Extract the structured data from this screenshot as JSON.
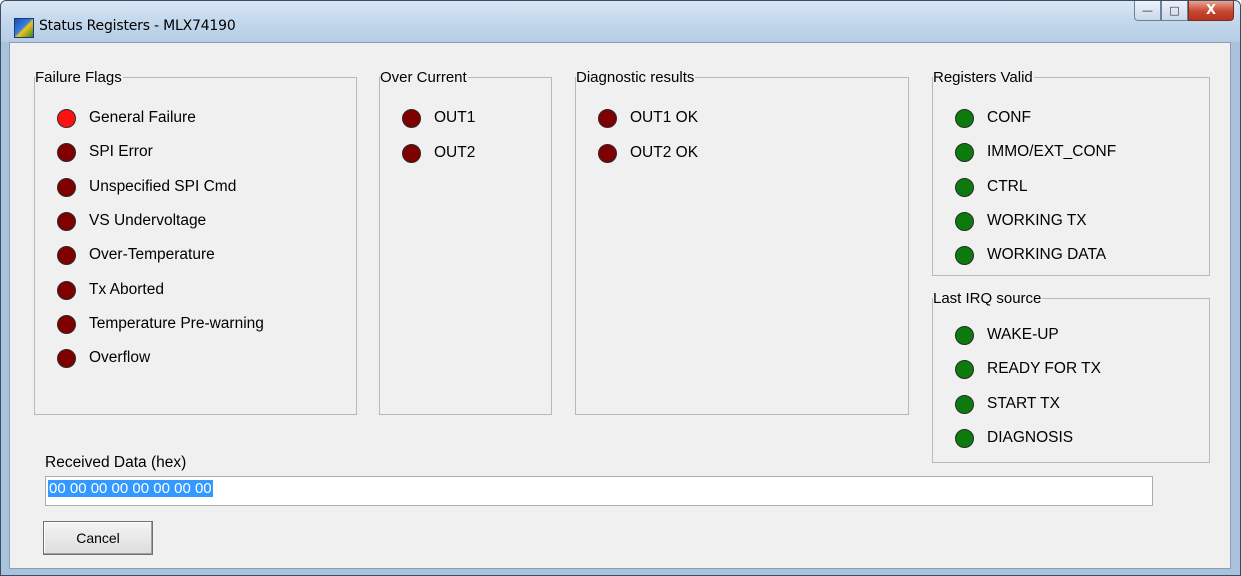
{
  "window": {
    "title": "Status Registers - MLX74190",
    "buttons": {
      "minimize": "—",
      "maximize": "□",
      "close": "X"
    }
  },
  "groups": {
    "failure_flags": {
      "title": "Failure Flags",
      "items": [
        {
          "label": "General Failure",
          "state": "bright-red"
        },
        {
          "label": "SPI Error",
          "state": "dark-red"
        },
        {
          "label": "Unspecified SPI Cmd",
          "state": "dark-red"
        },
        {
          "label": "VS Undervoltage",
          "state": "dark-red"
        },
        {
          "label": "Over-Temperature",
          "state": "dark-red"
        },
        {
          "label": "Tx Aborted",
          "state": "dark-red"
        },
        {
          "label": "Temperature Pre-warning",
          "state": "dark-red"
        },
        {
          "label": "Overflow",
          "state": "dark-red"
        }
      ]
    },
    "over_current": {
      "title": "Over Current",
      "items": [
        {
          "label": "OUT1",
          "state": "dark-red"
        },
        {
          "label": "OUT2",
          "state": "dark-red"
        }
      ]
    },
    "diagnostic_results": {
      "title": "Diagnostic results",
      "items": [
        {
          "label": "OUT1 OK",
          "state": "dark-red"
        },
        {
          "label": "OUT2 OK",
          "state": "dark-red"
        }
      ]
    },
    "registers_valid": {
      "title": "Registers Valid",
      "items": [
        {
          "label": "CONF",
          "state": "green"
        },
        {
          "label": "IMMO/EXT_CONF",
          "state": "green"
        },
        {
          "label": "CTRL",
          "state": "green"
        },
        {
          "label": "WORKING TX",
          "state": "green"
        },
        {
          "label": "WORKING DATA",
          "state": "green"
        }
      ]
    },
    "last_irq_source": {
      "title": "Last IRQ source",
      "items": [
        {
          "label": "WAKE-UP",
          "state": "green"
        },
        {
          "label": "READY FOR TX",
          "state": "green"
        },
        {
          "label": "START TX",
          "state": "green"
        },
        {
          "label": "DIAGNOSIS",
          "state": "green"
        }
      ]
    }
  },
  "received_data": {
    "label": "Received Data (hex)",
    "value": "00 00 00 00 00 00 00 00"
  },
  "cancel_button": {
    "label": "Cancel"
  },
  "colors": {
    "led_bright_red": "#ff1111",
    "led_dark_red": "#7f0000",
    "led_green": "#0d7a0d",
    "selection": "#3399ff"
  }
}
